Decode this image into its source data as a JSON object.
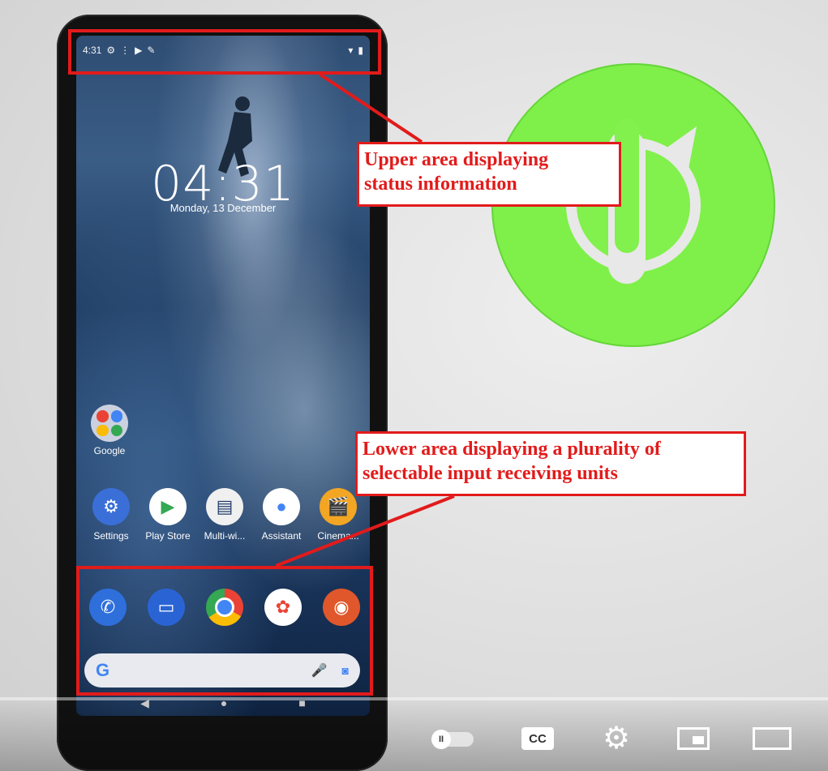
{
  "video": {
    "phone": {
      "lockscreen": {
        "status_time": "4:31",
        "clock": "04:31",
        "date": "Monday, 13 December"
      },
      "folder": {
        "label": "Google"
      },
      "apps": [
        {
          "label": "Settings",
          "icon": "gear-icon",
          "color": "#3b6fd8"
        },
        {
          "label": "Play Store",
          "icon": "play-icon",
          "color": "#ffffff"
        },
        {
          "label": "Multi-wi...",
          "icon": "multiwindow-icon",
          "color": "#f0f0f0"
        },
        {
          "label": "Assistant",
          "icon": "assistant-icon",
          "color": "#ffffff"
        },
        {
          "label": "Cinema...",
          "icon": "cinema-icon",
          "color": "#f2a623"
        }
      ],
      "dock": [
        {
          "icon": "phone-icon",
          "color": "#2e6fdc"
        },
        {
          "icon": "messages-icon",
          "color": "#2a64d4"
        },
        {
          "icon": "chrome-icon",
          "color": "#ffffff"
        },
        {
          "icon": "photos-icon",
          "color": "#ffffff"
        },
        {
          "icon": "camera-icon",
          "color": "#e0572b"
        }
      ],
      "search": {
        "logo": "G"
      }
    },
    "callouts": {
      "upper": "Upper area displaying status information",
      "upper_line1": "Upper area displaying",
      "upper_line2": "status information",
      "lower_line1": "Lower area displaying a plurality of",
      "lower_line2": "selectable input receiving units"
    },
    "accent_color": "#e21b1b",
    "power_logo_color": "#7ff04a"
  },
  "player": {
    "controls": [
      {
        "name": "autoplay-toggle",
        "icon": "toggle-icon"
      },
      {
        "name": "captions-button",
        "label": "CC"
      },
      {
        "name": "settings-button",
        "icon": "gear-icon"
      },
      {
        "name": "miniplayer-button",
        "icon": "miniplayer-icon"
      },
      {
        "name": "theater-button",
        "icon": "theater-icon"
      }
    ]
  }
}
